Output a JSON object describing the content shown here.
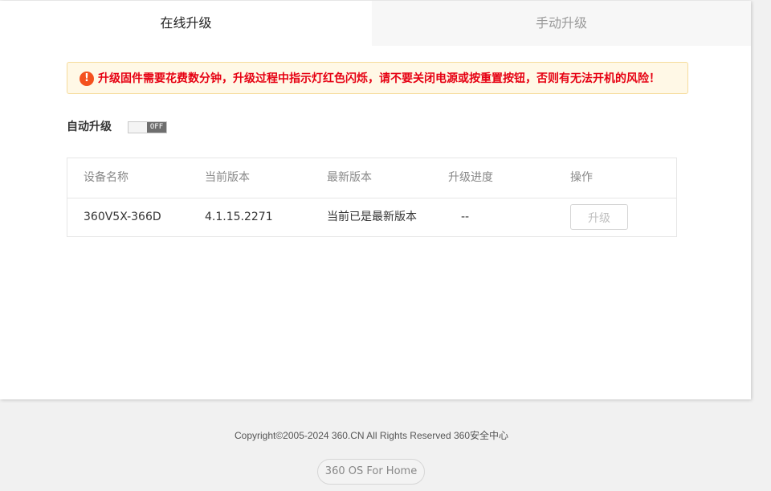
{
  "tabs": [
    {
      "label": "在线升级",
      "active": true
    },
    {
      "label": "手动升级",
      "active": false
    }
  ],
  "warning": {
    "icon": "exclamation-circle-icon",
    "icon_glyph": "!",
    "text": "升级固件需要花费数分钟，升级过程中指示灯红色闪烁，请不要关闭电源或按重置按钮，否则有无法开机的风险！",
    "text_color": "#e60012",
    "background": "#fff8e6"
  },
  "auto_upgrade": {
    "label": "自动升级",
    "toggle_state": "OFF"
  },
  "table": {
    "headers": [
      "设备名称",
      "当前版本",
      "最新版本",
      "升级进度",
      "操作"
    ],
    "rows": [
      {
        "device_name": "360V5X-366D",
        "current_version": "4.1.15.2271",
        "latest_version": "当前已是最新版本",
        "progress": "--",
        "action_label": "升级"
      }
    ]
  },
  "footer": {
    "copyright": "Copyright©2005-2024 360.CN All Rights Reserved 360安全中心",
    "badge": "360 OS For Home"
  }
}
